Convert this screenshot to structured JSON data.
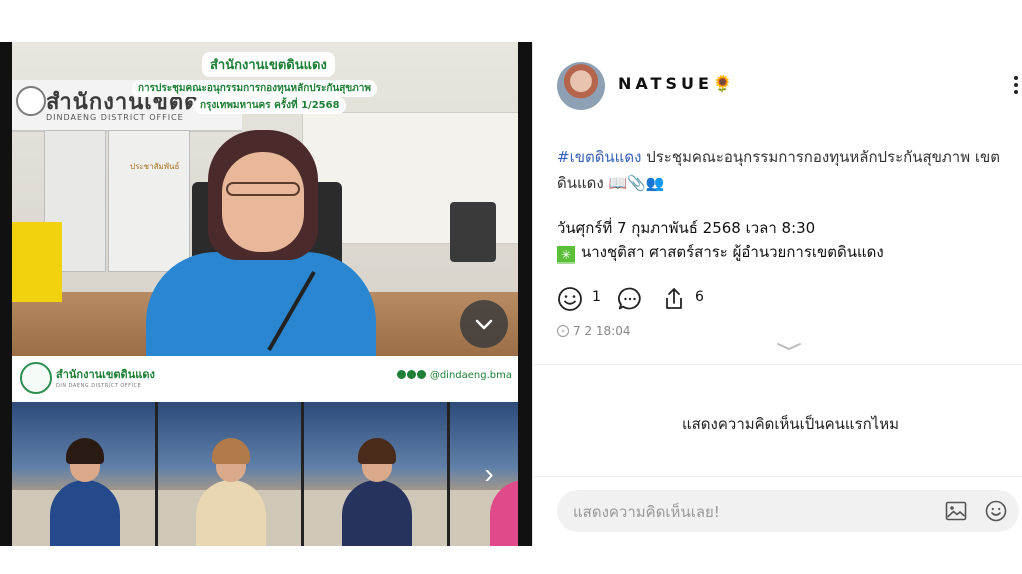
{
  "media": {
    "header_line1": "สำนักงานเขตดินแดง",
    "header_line2": "การประชุมคณะอนุกรรมการกองทุนหลักประกันสุขภาพ",
    "header_line3": "กรุงเทพมหานคร ครั้งที่ 1/2568",
    "office_sign_th": "สำนักงานเขตดินแดง",
    "office_sign_en": "DINDAENG DISTRICT OFFICE",
    "door_label": "ประชาสัมพันธ์",
    "footer_name": "สำนักงานเขตดินแดง",
    "footer_sub": "DIN DAENG DISTRICT OFFICE",
    "footer_handle": "@dindaeng.bma",
    "thumb_count": 4,
    "accent_green": "#1f7f36"
  },
  "post": {
    "username": "NATSUE🌻",
    "hashtag": "#เขตดินแดง",
    "caption": " ประชุมคณะอนุกรรมการกองทุนหลักประกันสุขภาพ เขตดินแดง 📖📎👥",
    "date_line": "วันศุกร์ที่ 7 กุมภาพันธ์ 2568 เวลา 8:30",
    "person_icon": "✳",
    "person_line": "นางชุติสา ศาสตร์สาระ ผู้อำนวยการเขตดินแดง",
    "likes": "1",
    "shares": "6",
    "timestamp": "7 2 18:04",
    "hashtag_color": "#3a62b8"
  },
  "comments": {
    "empty_message": "แสดงความคิดเห็นเป็นคนแรกไหม",
    "placeholder": "แสดงความคิดเห็นเลย!"
  }
}
